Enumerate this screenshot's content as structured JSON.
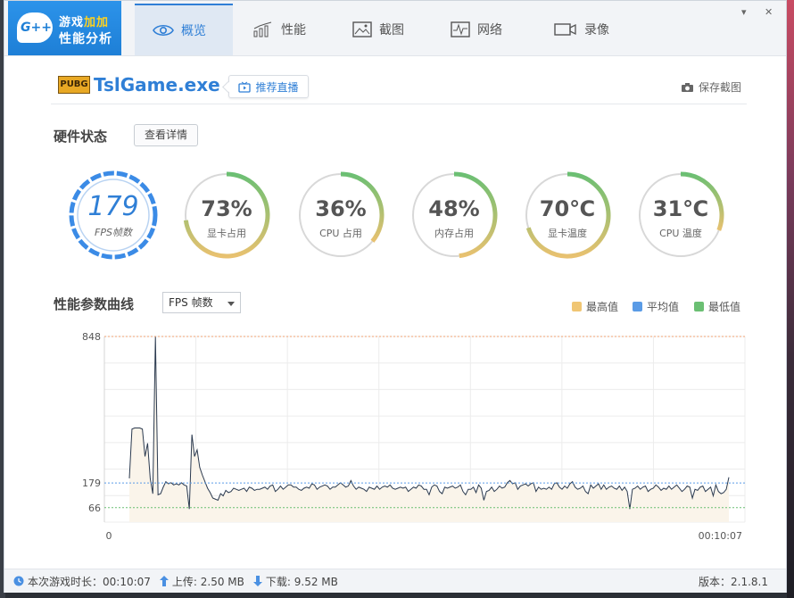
{
  "app": {
    "logo_badge": "G++",
    "logo_line1_a": "游戏",
    "logo_line1_b": "加加",
    "logo_line2": "性能分析"
  },
  "tabs": [
    {
      "label": "概览",
      "icon": "eye-icon",
      "active": true
    },
    {
      "label": "性能",
      "icon": "bar-chart-icon",
      "active": false
    },
    {
      "label": "截图",
      "icon": "image-icon",
      "active": false
    },
    {
      "label": "网络",
      "icon": "pulse-icon",
      "active": false
    },
    {
      "label": "录像",
      "icon": "video-camera-icon",
      "active": false
    }
  ],
  "window_controls": {
    "collapse": "▾",
    "close": "✕"
  },
  "game": {
    "badge": "PUBG",
    "title": "TslGame.exe",
    "recommend_label": "推荐直播",
    "save_label": "保存截图"
  },
  "hardware": {
    "title": "硬件状态",
    "detail_button": "查看详情",
    "gauges": [
      {
        "value": "179",
        "label": "FPS帧数",
        "kind": "fps"
      },
      {
        "value": "73%",
        "label": "显卡占用",
        "fraction": 0.73
      },
      {
        "value": "36%",
        "label": "CPU 占用",
        "fraction": 0.36
      },
      {
        "value": "48%",
        "label": "内存占用",
        "fraction": 0.48
      },
      {
        "value": "70℃",
        "label": "显卡温度",
        "fraction": 0.7
      },
      {
        "value": "31℃",
        "label": "CPU 温度",
        "fraction": 0.31
      }
    ]
  },
  "curve": {
    "title": "性能参数曲线",
    "select_value": "FPS 帧数",
    "legend": [
      {
        "label": "最高值",
        "color": "#f0c674"
      },
      {
        "label": "平均值",
        "color": "#5a9be6"
      },
      {
        "label": "最低值",
        "color": "#6bbf73"
      }
    ]
  },
  "chart_data": {
    "type": "area",
    "ylim": [
      0,
      848
    ],
    "yticks": [
      "848",
      "179",
      "66"
    ],
    "xticks": [
      "0",
      "00:10:07"
    ],
    "max": 848,
    "avg": 179,
    "min": 66,
    "values": [
      200,
      425,
      430,
      430,
      430,
      425,
      300,
      360,
      200,
      130,
      848,
      125,
      130,
      160,
      185,
      175,
      180,
      170,
      175,
      170,
      180,
      170,
      165,
      60,
      400,
      300,
      330,
      250,
      215,
      185,
      155,
      135,
      110,
      105,
      100,
      130,
      120,
      145,
      135,
      140,
      155,
      150,
      145,
      150,
      155,
      140,
      160,
      155,
      145,
      150,
      150,
      155,
      160,
      150,
      165,
      170,
      140,
      150,
      165,
      150,
      160,
      170,
      170,
      160,
      160,
      150,
      145,
      155,
      160,
      155,
      175,
      170,
      150,
      160,
      165,
      170,
      165,
      150,
      160,
      160,
      170,
      180,
      170,
      160,
      165,
      190,
      165,
      150,
      160,
      155,
      150,
      140,
      160,
      155,
      150,
      165,
      150,
      160,
      165,
      160,
      170,
      155,
      150,
      155,
      160,
      155,
      160,
      140,
      150,
      160,
      155,
      170,
      165,
      150,
      150,
      125,
      160,
      170,
      165,
      140,
      130,
      160,
      155,
      160,
      165,
      155,
      160,
      170,
      140,
      125,
      150,
      150,
      160,
      135,
      170,
      155,
      100,
      140,
      145,
      160,
      140,
      150,
      165,
      155,
      160,
      180,
      190,
      175,
      180,
      150,
      165,
      170,
      175,
      165,
      175,
      180,
      140,
      160,
      150,
      155,
      150,
      160,
      150,
      175,
      180,
      160,
      150,
      165,
      155,
      175,
      185,
      160,
      150,
      155,
      165,
      140,
      130,
      170,
      155,
      165,
      175,
      150,
      170,
      150,
      160,
      165,
      155,
      150,
      165,
      145,
      160,
      140,
      60,
      150,
      155,
      165,
      150,
      160,
      165,
      140,
      150,
      155,
      170,
      160,
      145,
      155,
      150,
      165,
      150,
      160,
      170,
      155,
      140,
      150,
      165,
      160,
      110,
      150,
      145,
      160,
      165,
      140,
      150,
      160,
      120,
      170,
      140,
      130,
      135,
      150,
      205
    ]
  },
  "status": {
    "duration_label": "本次游戏时长：00:10:07",
    "upload_label": "上传: 2.50 MB",
    "download_label": "下载: 9.52 MB",
    "version_label": "版本：2.1.8.1"
  }
}
